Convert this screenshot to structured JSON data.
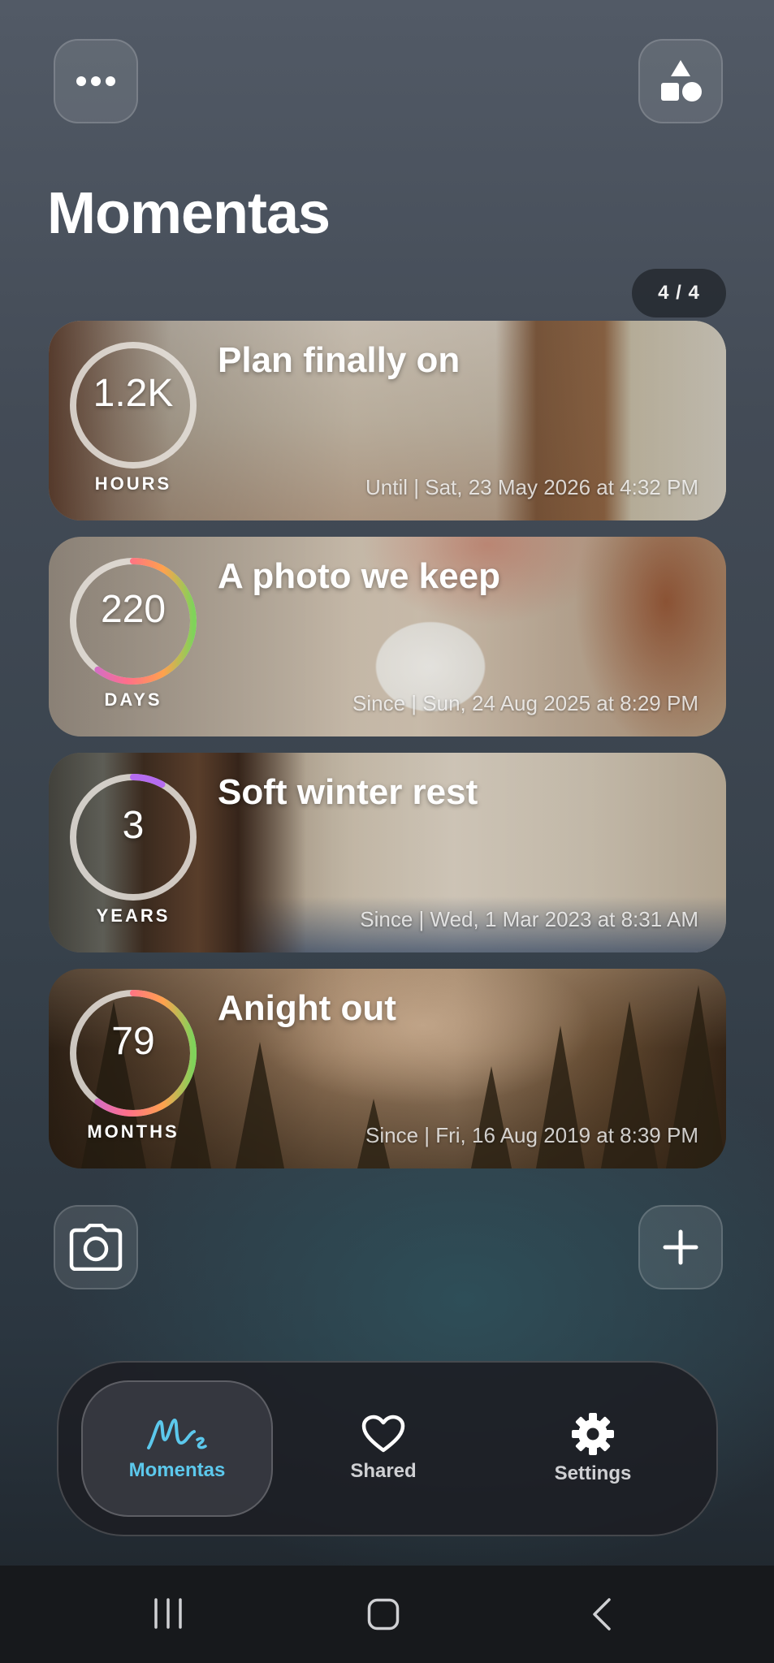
{
  "header": {
    "menu_icon": "more-horizontal-icon",
    "shapes_icon": "shapes-icon",
    "title": "Momentas",
    "counter": "4 / 4"
  },
  "cards": [
    {
      "title": "Plan finally on",
      "value": "1.2K",
      "unit": "HOURS",
      "date": "Until | Sat, 23 May 2026 at 4:32 PM",
      "progress": 0,
      "image": "notebook-writing-photo"
    },
    {
      "title": "A photo we keep",
      "value": "220",
      "unit": "DAYS",
      "date": "Since | Sun, 24 Aug 2025 at 8:29 PM",
      "progress": 0.6,
      "image": "polaroid-photo"
    },
    {
      "title": "Soft winter rest",
      "value": "3",
      "unit": "YEARS",
      "date": "Since | Wed, 1 Mar 2023 at 8:31 AM",
      "progress": 0.08,
      "image": "sweater-window-photo"
    },
    {
      "title": "Anight out",
      "value": "79",
      "unit": "MONTHS",
      "date": "Since | Fri, 16 Aug 2019 at 8:39 PM",
      "progress": 0.6,
      "image": "foggy-forest-photo"
    }
  ],
  "actions": {
    "camera_icon": "camera-icon",
    "add_icon": "plus-icon"
  },
  "nav": {
    "items": [
      {
        "label": "Momentas",
        "icon": "momentas-logo-icon",
        "active": true
      },
      {
        "label": "Shared",
        "icon": "heart-icon",
        "active": false
      },
      {
        "label": "Settings",
        "icon": "gear-icon",
        "active": false
      }
    ]
  },
  "colors": {
    "accent": "#5cc8ec",
    "ring_track": "#d9d6d2"
  }
}
